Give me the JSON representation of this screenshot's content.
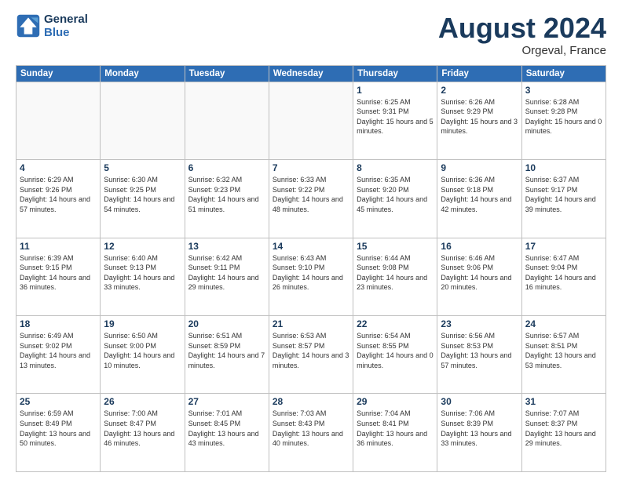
{
  "header": {
    "logo_line1": "General",
    "logo_line2": "Blue",
    "month_title": "August 2024",
    "subtitle": "Orgeval, France"
  },
  "weekdays": [
    "Sunday",
    "Monday",
    "Tuesday",
    "Wednesday",
    "Thursday",
    "Friday",
    "Saturday"
  ],
  "weeks": [
    [
      {
        "day": "",
        "info": ""
      },
      {
        "day": "",
        "info": ""
      },
      {
        "day": "",
        "info": ""
      },
      {
        "day": "",
        "info": ""
      },
      {
        "day": "1",
        "info": "Sunrise: 6:25 AM\nSunset: 9:31 PM\nDaylight: 15 hours\nand 5 minutes."
      },
      {
        "day": "2",
        "info": "Sunrise: 6:26 AM\nSunset: 9:29 PM\nDaylight: 15 hours\nand 3 minutes."
      },
      {
        "day": "3",
        "info": "Sunrise: 6:28 AM\nSunset: 9:28 PM\nDaylight: 15 hours\nand 0 minutes."
      }
    ],
    [
      {
        "day": "4",
        "info": "Sunrise: 6:29 AM\nSunset: 9:26 PM\nDaylight: 14 hours\nand 57 minutes."
      },
      {
        "day": "5",
        "info": "Sunrise: 6:30 AM\nSunset: 9:25 PM\nDaylight: 14 hours\nand 54 minutes."
      },
      {
        "day": "6",
        "info": "Sunrise: 6:32 AM\nSunset: 9:23 PM\nDaylight: 14 hours\nand 51 minutes."
      },
      {
        "day": "7",
        "info": "Sunrise: 6:33 AM\nSunset: 9:22 PM\nDaylight: 14 hours\nand 48 minutes."
      },
      {
        "day": "8",
        "info": "Sunrise: 6:35 AM\nSunset: 9:20 PM\nDaylight: 14 hours\nand 45 minutes."
      },
      {
        "day": "9",
        "info": "Sunrise: 6:36 AM\nSunset: 9:18 PM\nDaylight: 14 hours\nand 42 minutes."
      },
      {
        "day": "10",
        "info": "Sunrise: 6:37 AM\nSunset: 9:17 PM\nDaylight: 14 hours\nand 39 minutes."
      }
    ],
    [
      {
        "day": "11",
        "info": "Sunrise: 6:39 AM\nSunset: 9:15 PM\nDaylight: 14 hours\nand 36 minutes."
      },
      {
        "day": "12",
        "info": "Sunrise: 6:40 AM\nSunset: 9:13 PM\nDaylight: 14 hours\nand 33 minutes."
      },
      {
        "day": "13",
        "info": "Sunrise: 6:42 AM\nSunset: 9:11 PM\nDaylight: 14 hours\nand 29 minutes."
      },
      {
        "day": "14",
        "info": "Sunrise: 6:43 AM\nSunset: 9:10 PM\nDaylight: 14 hours\nand 26 minutes."
      },
      {
        "day": "15",
        "info": "Sunrise: 6:44 AM\nSunset: 9:08 PM\nDaylight: 14 hours\nand 23 minutes."
      },
      {
        "day": "16",
        "info": "Sunrise: 6:46 AM\nSunset: 9:06 PM\nDaylight: 14 hours\nand 20 minutes."
      },
      {
        "day": "17",
        "info": "Sunrise: 6:47 AM\nSunset: 9:04 PM\nDaylight: 14 hours\nand 16 minutes."
      }
    ],
    [
      {
        "day": "18",
        "info": "Sunrise: 6:49 AM\nSunset: 9:02 PM\nDaylight: 14 hours\nand 13 minutes."
      },
      {
        "day": "19",
        "info": "Sunrise: 6:50 AM\nSunset: 9:00 PM\nDaylight: 14 hours\nand 10 minutes."
      },
      {
        "day": "20",
        "info": "Sunrise: 6:51 AM\nSunset: 8:59 PM\nDaylight: 14 hours\nand 7 minutes."
      },
      {
        "day": "21",
        "info": "Sunrise: 6:53 AM\nSunset: 8:57 PM\nDaylight: 14 hours\nand 3 minutes."
      },
      {
        "day": "22",
        "info": "Sunrise: 6:54 AM\nSunset: 8:55 PM\nDaylight: 14 hours\nand 0 minutes."
      },
      {
        "day": "23",
        "info": "Sunrise: 6:56 AM\nSunset: 8:53 PM\nDaylight: 13 hours\nand 57 minutes."
      },
      {
        "day": "24",
        "info": "Sunrise: 6:57 AM\nSunset: 8:51 PM\nDaylight: 13 hours\nand 53 minutes."
      }
    ],
    [
      {
        "day": "25",
        "info": "Sunrise: 6:59 AM\nSunset: 8:49 PM\nDaylight: 13 hours\nand 50 minutes."
      },
      {
        "day": "26",
        "info": "Sunrise: 7:00 AM\nSunset: 8:47 PM\nDaylight: 13 hours\nand 46 minutes."
      },
      {
        "day": "27",
        "info": "Sunrise: 7:01 AM\nSunset: 8:45 PM\nDaylight: 13 hours\nand 43 minutes."
      },
      {
        "day": "28",
        "info": "Sunrise: 7:03 AM\nSunset: 8:43 PM\nDaylight: 13 hours\nand 40 minutes."
      },
      {
        "day": "29",
        "info": "Sunrise: 7:04 AM\nSunset: 8:41 PM\nDaylight: 13 hours\nand 36 minutes."
      },
      {
        "day": "30",
        "info": "Sunrise: 7:06 AM\nSunset: 8:39 PM\nDaylight: 13 hours\nand 33 minutes."
      },
      {
        "day": "31",
        "info": "Sunrise: 7:07 AM\nSunset: 8:37 PM\nDaylight: 13 hours\nand 29 minutes."
      }
    ]
  ]
}
